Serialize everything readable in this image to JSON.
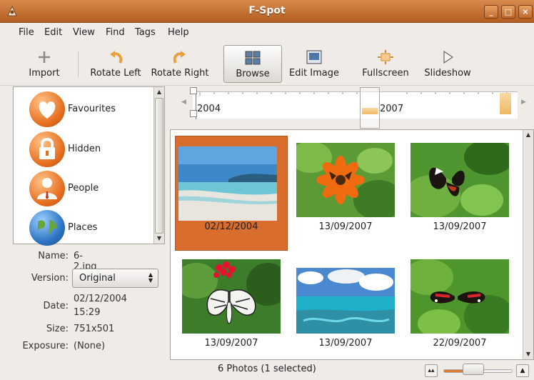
{
  "window": {
    "title": "F-Spot",
    "controls": {
      "minimize": "_",
      "maximize": "□",
      "close": "×"
    }
  },
  "menu": [
    "File",
    "Edit",
    "View",
    "Find",
    "Tags",
    "Help"
  ],
  "toolbar": {
    "import": "Import",
    "rotate_left": "Rotate Left",
    "rotate_right": "Rotate Right",
    "browse": "Browse",
    "edit_image": "Edit Image",
    "fullscreen": "Fullscreen",
    "slideshow": "Slideshow",
    "active": "browse"
  },
  "tags": [
    {
      "label": "Favourites",
      "icon": "heart-icon"
    },
    {
      "label": "Hidden",
      "icon": "lock-icon"
    },
    {
      "label": "People",
      "icon": "person-icon"
    },
    {
      "label": "Places",
      "icon": "globe-icon"
    }
  ],
  "info": {
    "name_label": "Name:",
    "name": "6-2.jpg",
    "version_label": "Version:",
    "version": "Original",
    "date_label": "Date:",
    "date": "02/12/2004",
    "time": "15:29",
    "size_label": "Size:",
    "size": "751x501",
    "exposure_label": "Exposure:",
    "exposure": "(None)"
  },
  "timeline": {
    "start_year": "2004",
    "end_year": "2007"
  },
  "photos": [
    {
      "date": "02/12/2004",
      "subject": "beach",
      "selected": true
    },
    {
      "date": "13/09/2007",
      "subject": "orange flower",
      "selected": false
    },
    {
      "date": "13/09/2007",
      "subject": "butterfly on leaves",
      "selected": false
    },
    {
      "date": "13/09/2007",
      "subject": "white butterfly",
      "selected": false
    },
    {
      "date": "13/09/2007",
      "subject": "ocean reef",
      "selected": false
    },
    {
      "date": "22/09/2007",
      "subject": "red butterfly",
      "selected": false
    }
  ],
  "status": {
    "text": "6 Photos (1 selected)",
    "zoom_level": 0.4
  },
  "colors": {
    "accent": "#d86d2e",
    "titlebar": "#c56f33"
  }
}
